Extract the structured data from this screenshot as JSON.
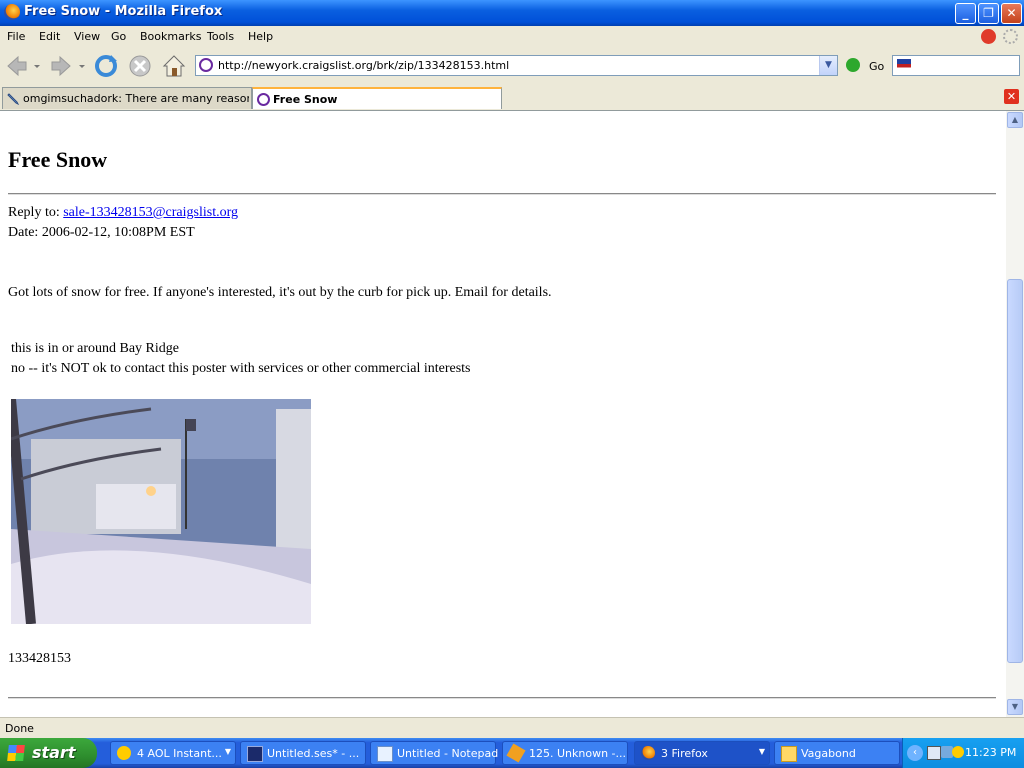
{
  "window": {
    "title": "Free Snow - Mozilla Firefox"
  },
  "menu": [
    "File",
    "Edit",
    "View",
    "Go",
    "Bookmarks",
    "Tools",
    "Help"
  ],
  "toolbar": {
    "url": "http://newyork.craigslist.org/brk/zip/133428153.html",
    "go_label": "Go"
  },
  "tabs": [
    {
      "label": "omgimsuchadork: There are many reasons I...",
      "active": false
    },
    {
      "label": "Free Snow",
      "active": true
    }
  ],
  "page": {
    "title": "Free Snow",
    "reply_label": "Reply to:",
    "reply_email": "sale-133428153@craigslist.org",
    "date": "Date: 2006-02-12, 10:08PM EST",
    "body": "Got lots of snow for free. If anyone's interested, it's out by the curb for pick up. Email for details.",
    "location": "this is in or around Bay Ridge",
    "notice": "no -- it's NOT ok to contact this poster with services or other commercial interests",
    "post_id": "133428153"
  },
  "status": {
    "text": "Done"
  },
  "taskbar": {
    "start_label": "start",
    "items": [
      {
        "label": "4 AOL Instant...",
        "icon": "aim-icon",
        "active": false
      },
      {
        "label": "Untitled.ses* - ...",
        "icon": "audio-editor-icon",
        "active": false
      },
      {
        "label": "Untitled - Notepad",
        "icon": "notepad-icon",
        "active": false
      },
      {
        "label": "125. Unknown -...",
        "icon": "winamp-icon",
        "active": false
      },
      {
        "label": "3 Firefox",
        "icon": "firefox-icon",
        "active": true
      },
      {
        "label": "Vagabond",
        "icon": "folder-icon",
        "active": false
      }
    ],
    "clock": "11:23 PM"
  }
}
